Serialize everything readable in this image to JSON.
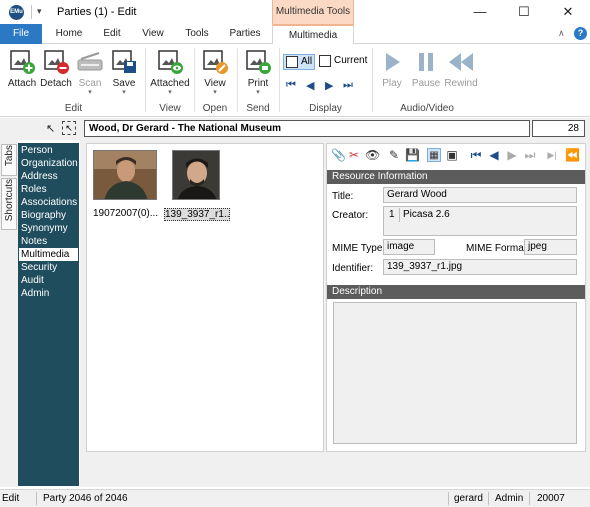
{
  "window": {
    "title": "Parties (1) - Edit",
    "logo_text": "EMu",
    "context_tab_header": "Multimedia Tools",
    "minimize": "—",
    "maximize": "☐",
    "close": "✕",
    "qa_dropdown": "▾"
  },
  "ribbon_tabs": {
    "file": "File",
    "home": "Home",
    "edit": "Edit",
    "view": "View",
    "tools": "Tools",
    "parties": "Parties",
    "multimedia": "Multimedia",
    "collapse": "∧",
    "help": "?"
  },
  "ribbon": {
    "attach": "Attach",
    "detach": "Detach",
    "scan": "Scan",
    "save": "Save",
    "attached": "Attached",
    "view": "View",
    "print": "Print",
    "all": "All",
    "current": "Current",
    "play": "Play",
    "pause": "Pause",
    "rewind": "Rewind",
    "groups": {
      "edit": "Edit",
      "view": "View",
      "open": "Open",
      "send": "Send",
      "display": "Display",
      "audio_video": "Audio/Video"
    }
  },
  "record": {
    "title": "Wood, Dr Gerard - The National Museum",
    "number": "28"
  },
  "side_tabs": {
    "tabs": "Tabs",
    "shortcuts": "Shortcuts"
  },
  "nav": {
    "items": [
      "Person",
      "Organization",
      "Address",
      "Roles",
      "Associations",
      "Biography",
      "Synonymy",
      "Notes",
      "Multimedia",
      "Security",
      "Audit",
      "Admin"
    ],
    "active": "Multimedia"
  },
  "thumbnails": [
    {
      "caption": "19072007(0)....",
      "selected": false
    },
    {
      "caption": "139_3937_r1....",
      "selected": true
    }
  ],
  "resource": {
    "header": "Resource Information",
    "title_label": "Title:",
    "title_value": "Gerard Wood",
    "creator_label": "Creator:",
    "creator_index": "1",
    "creator_value": "Picasa 2.6",
    "mime_type_label": "MIME Type:",
    "mime_type_value": "image",
    "mime_format_label": "MIME Format:",
    "mime_format_value": "jpeg",
    "identifier_label": "Identifier:",
    "identifier_value": "139_3937_r1.jpg"
  },
  "description": {
    "header": "Description"
  },
  "status": {
    "mode": "Edit",
    "position": "Party 2046 of 2046",
    "user": "gerard",
    "group": "Admin",
    "code": "20007"
  },
  "colors": {
    "file_tab": "#2b78c5",
    "context_tab": "#fbd9c4",
    "nav_panel": "#1f4d5e",
    "section_header": "#5c5c5c"
  }
}
